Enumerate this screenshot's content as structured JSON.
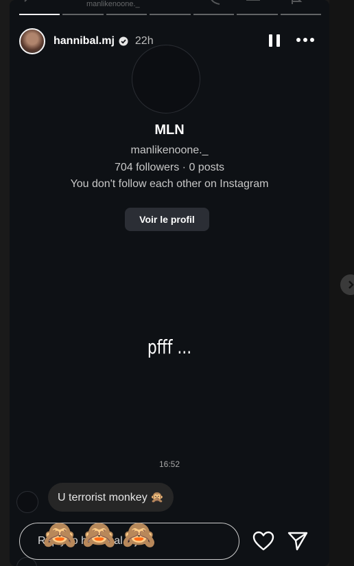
{
  "story": {
    "progress_segments": 7,
    "active_segment": 0,
    "ghost_handle": "manlikenoone._",
    "header": {
      "username": "hannibal.mj",
      "verified": true,
      "time_ago": "22h",
      "pause_icon": "pause-icon",
      "more_icon": "more-icon"
    },
    "profile_card": {
      "display_name": "MLN",
      "handle": "manlikenoone._",
      "stats": "704 followers · 0 posts",
      "follow_note": "You don't follow each other on Instagram",
      "view_profile_label": "Voir le profil"
    },
    "caption": "pfff ...",
    "message": {
      "time": "16:52",
      "text": "U terrorist monkey 🙊"
    },
    "reply": {
      "placeholder": "Reply to hannibal.mj...",
      "overlay_emojis": "🙈🙈🙈"
    },
    "icons": {
      "like": "heart-icon",
      "send": "send-icon",
      "next": "chevron-right-icon"
    },
    "colors": {
      "background": "#0e1115",
      "button": "#2b2e35",
      "bubble": "#262626"
    }
  }
}
